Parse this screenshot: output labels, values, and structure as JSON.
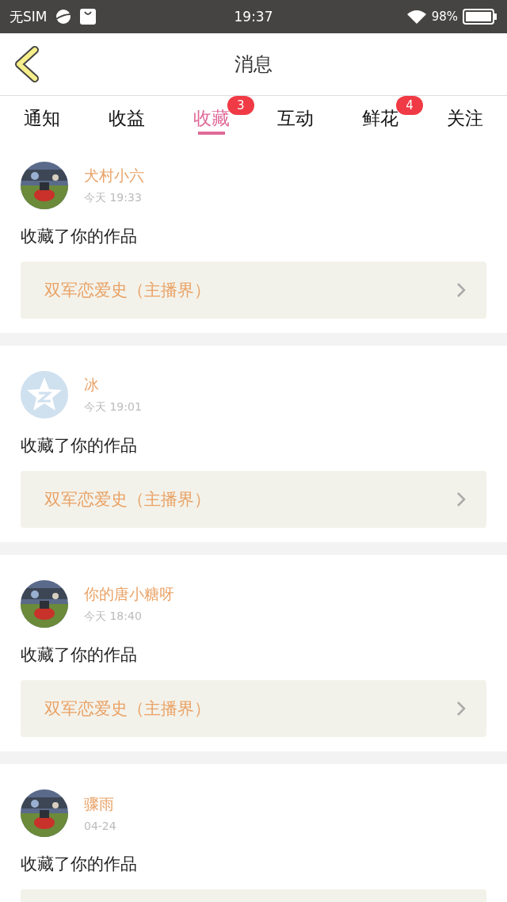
{
  "status_bar": {
    "carrier": "无SIM",
    "time": "19:37",
    "battery": "98%"
  },
  "header": {
    "title": "消息"
  },
  "tabs": [
    {
      "label": "通知",
      "selected": false
    },
    {
      "label": "收益",
      "selected": false
    },
    {
      "label": "收藏",
      "selected": true,
      "badge": "3"
    },
    {
      "label": "互动",
      "selected": false
    },
    {
      "label": "鲜花",
      "selected": false,
      "badge": "4"
    },
    {
      "label": "关注",
      "selected": false
    }
  ],
  "messages": [
    {
      "name": "犬村小六",
      "time": "今天 19:33",
      "text": "收藏了你的作品",
      "work": "双军恋爱史（主播界）"
    },
    {
      "avatar": {
        "kind": "default"
      },
      "name": "冰",
      "time": "今天 19:01",
      "text": "收藏了你的作品",
      "work": "双军恋爱史（主播界）"
    },
    {
      "name": "你的唐小糖呀",
      "time": "今天 18:40",
      "text": "收藏了你的作品",
      "work": "双军恋爱史（主播界）"
    },
    {
      "name": "骤雨",
      "time": "04-24",
      "text": "收藏了你的作品"
    }
  ]
}
